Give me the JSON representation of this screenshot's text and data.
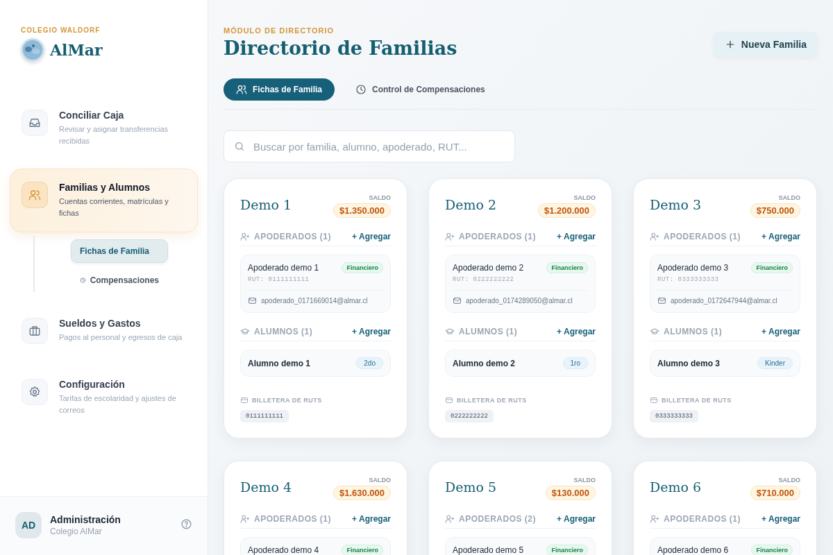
{
  "sidebar": {
    "eyebrow": "COLEGIO WALDORF",
    "brand": "AlMar",
    "nav": [
      {
        "title": "Conciliar Caja",
        "subtitle": "Revisar y asignar transferencias recibidas",
        "selected": false
      },
      {
        "title": "Familias y Alumnos",
        "subtitle": "Cuentas corrientes, matrículas y fichas",
        "selected": true,
        "children": [
          {
            "label": "Fichas de Familia",
            "selected": true
          },
          {
            "label": "Compensaciones",
            "selected": false
          }
        ]
      },
      {
        "title": "Sueldos y Gastos",
        "subtitle": "Pagos al personal y egresos de caja",
        "selected": false
      },
      {
        "title": "Configuración",
        "subtitle": "Tarifas de escolaridad y ajustes de correos",
        "selected": false
      }
    ],
    "user": {
      "initials": "AD",
      "name": "Administración",
      "org": "Colegio AlMar"
    }
  },
  "header": {
    "eyebrow": "MÓDULO DE DIRECTORIO",
    "title": "Directorio de Familias",
    "action": "Nueva Familia"
  },
  "tabs": [
    {
      "label": "Fichas de Familia",
      "selected": true
    },
    {
      "label": "Control de Compensaciones",
      "selected": false
    }
  ],
  "search": {
    "placeholder": "Buscar por familia, alumno, apoderado, RUT..."
  },
  "families": [
    {
      "name": "Demo 1",
      "balance_label": "SALDO",
      "balance": "$1.350.000",
      "guardians_label": "APODERADOS (1)",
      "guardians_add": "+ Agregar",
      "guardians": [
        {
          "name": "Apoderado demo 1",
          "role": "Financiero",
          "rut": "RUT: 0111111111",
          "email": "apoderado_0171669014@almar.cl"
        }
      ],
      "students_label": "ALUMNOS (1)",
      "students_add": "+ Agregar",
      "students": [
        {
          "name": "Alumno demo 1",
          "grade": "2do"
        }
      ],
      "wallet_label": "BILLETERA DE RUTS",
      "wallet": [
        "0111111111"
      ]
    },
    {
      "name": "Demo 2",
      "balance_label": "SALDO",
      "balance": "$1.200.000",
      "guardians_label": "APODERADOS (1)",
      "guardians_add": "+ Agregar",
      "guardians": [
        {
          "name": "Apoderado demo 2",
          "role": "Financiero",
          "rut": "RUT: 0222222222",
          "email": "apoderado_0174289050@almar.cl"
        }
      ],
      "students_label": "ALUMNOS (1)",
      "students_add": "+ Agregar",
      "students": [
        {
          "name": "Alumno demo 2",
          "grade": "1ro"
        }
      ],
      "wallet_label": "BILLETERA DE RUTS",
      "wallet": [
        "0222222222"
      ]
    },
    {
      "name": "Demo 3",
      "balance_label": "SALDO",
      "balance": "$750.000",
      "guardians_label": "APODERADOS (1)",
      "guardians_add": "+ Agregar",
      "guardians": [
        {
          "name": "Apoderado demo 3",
          "role": "Financiero",
          "rut": "RUT: 0333333333",
          "email": "apoderado_0172647944@almar.cl"
        }
      ],
      "students_label": "ALUMNOS (1)",
      "students_add": "+ Agregar",
      "students": [
        {
          "name": "Alumno demo 3",
          "grade": "Kinder"
        }
      ],
      "wallet_label": "BILLETERA DE RUTS",
      "wallet": [
        "0333333333"
      ]
    },
    {
      "name": "Demo 4",
      "balance_label": "SALDO",
      "balance": "$1.630.000",
      "guardians_label": "APODERADOS (1)",
      "guardians_add": "+ Agregar",
      "guardians": [
        {
          "name": "Apoderado demo 4",
          "role": "Financiero"
        }
      ]
    },
    {
      "name": "Demo 5",
      "balance_label": "SALDO",
      "balance": "$130.000",
      "guardians_label": "APODERADOS (2)",
      "guardians_add": "+ Agregar",
      "guardians": [
        {
          "name": "Apoderado demo 5",
          "role": "Financiero"
        }
      ]
    },
    {
      "name": "Demo 6",
      "balance_label": "SALDO",
      "balance": "$710.000",
      "guardians_label": "APODERADOS (1)",
      "guardians_add": "+ Agregar",
      "guardians": [
        {
          "name": "Apoderado demo 6",
          "role": "Financiero"
        }
      ]
    }
  ]
}
